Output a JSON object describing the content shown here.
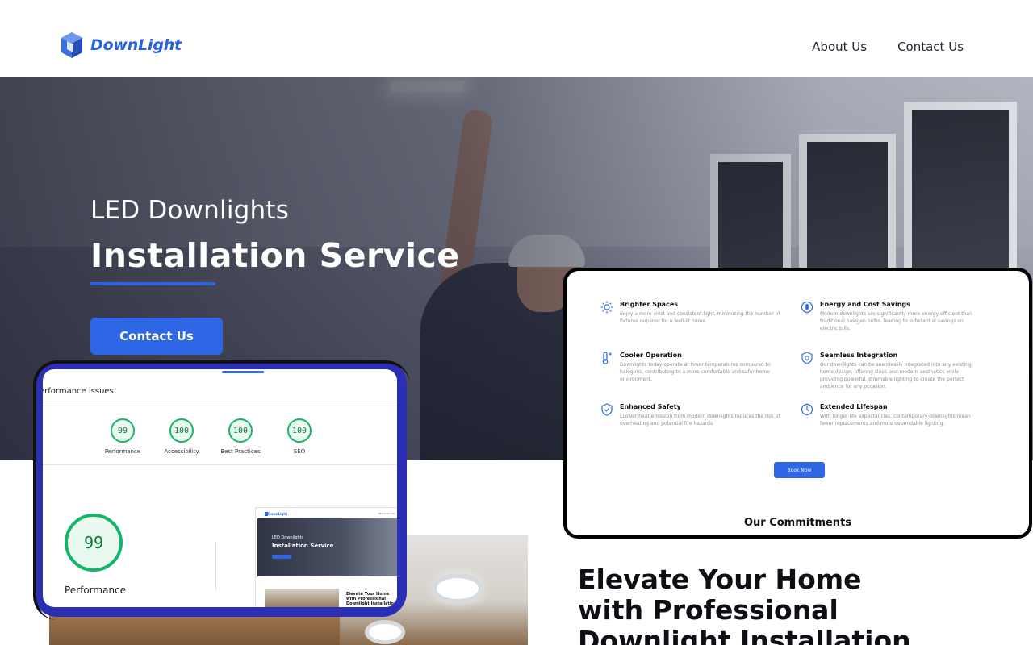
{
  "header": {
    "brand": "DownLight",
    "nav": [
      "About Us",
      "Contact Us"
    ]
  },
  "hero": {
    "subtitle": "LED Downlights",
    "title": "Installation Service",
    "cta": "Contact Us"
  },
  "section": {
    "heading_line1": "Elevate Your Home",
    "heading_line2": "with Professional",
    "heading_line3": "Downlight Installation"
  },
  "lighthouse": {
    "issues_label": "erformance issues",
    "scores": [
      {
        "value": "99",
        "label": "Performance"
      },
      {
        "value": "100",
        "label": "Accessibility"
      },
      {
        "value": "100",
        "label": "Best Practices"
      },
      {
        "value": "100",
        "label": "SEO"
      }
    ],
    "main_score": "99",
    "main_label": "Performance",
    "preview": {
      "brand": "DownLight",
      "nav": "About Us   Con",
      "hero_sub": "LED Downlights",
      "hero_title": "Installation Service",
      "heading": "Elevate Your Home with Professional Downlight Installation"
    }
  },
  "features": {
    "items": [
      {
        "icon": "sun-icon",
        "title": "Brighter Spaces",
        "desc": "Enjoy a more vivid and consistent light, minimizing the number of fixtures required for a well-lit home."
      },
      {
        "icon": "energy-icon",
        "title": "Energy and Cost Savings",
        "desc": "Modern downlights are significantly more energy-efficient than traditional halogen bulbs, leading to substantial savings on electric bills."
      },
      {
        "icon": "thermometer-icon",
        "title": "Cooler Operation",
        "desc": "Downlights today operate at lower temperatures compared to halogens, contributing to a more comfortable and safer home environment."
      },
      {
        "icon": "shield-icon",
        "title": "Seamless Integration",
        "desc": "Our downlights can be seamlessly integrated into any existing home design, offering sleek and modern aesthetics while providing powerful, dimmable lighting to create the perfect ambience for any occasion."
      },
      {
        "icon": "safety-shield-icon",
        "title": "Enhanced Safety",
        "desc": "LLower heat emission from modern downlights reduces the risk of overheating and potential fire hazards."
      },
      {
        "icon": "clock-icon",
        "title": "Extended Lifespan",
        "desc": "With longer life expectancies, contemporary downlights mean fewer replacements and more dependable lighting."
      }
    ],
    "book_label": "Book Now",
    "commitments": "Our Commitments"
  },
  "colors": {
    "brand_blue": "#2d67e6",
    "score_green": "#12b76a",
    "card_border": "#2b2fb5"
  }
}
